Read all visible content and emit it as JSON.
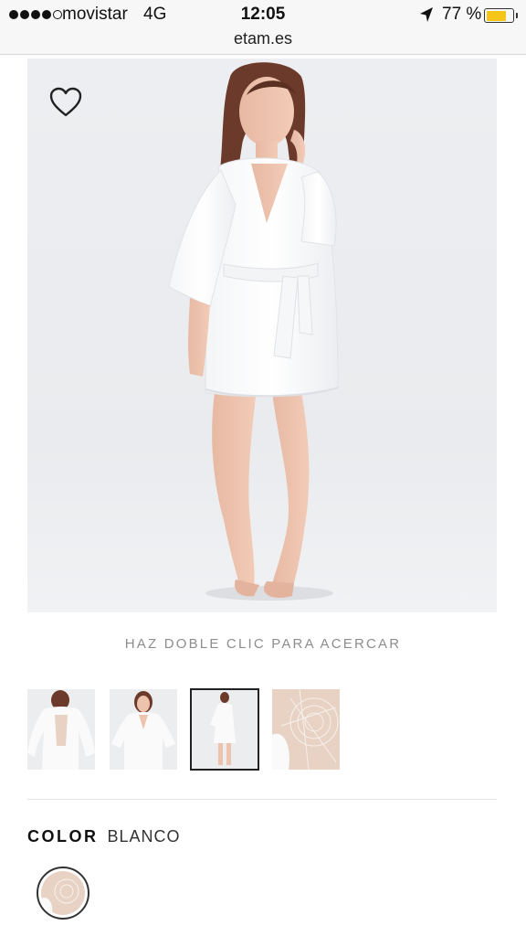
{
  "status_bar": {
    "signal_bars_filled": 4,
    "signal_bars_total": 5,
    "carrier": "movistar",
    "network": "4G",
    "time": "12:05",
    "battery_percent": "77 %",
    "battery_level": 0.77,
    "battery_color": "#f5c518",
    "location_icon": "location-arrow-icon"
  },
  "browser": {
    "url": "etam.es"
  },
  "product": {
    "favorite_icon": "heart-outline-icon",
    "zoom_hint": "HAZ DOBLE CLIC PARA ACERCAR",
    "thumbnails": [
      {
        "view": "back view with lace panel",
        "selected": false
      },
      {
        "view": "front view waist up",
        "selected": false
      },
      {
        "view": "full body front view",
        "selected": true
      },
      {
        "view": "lace detail close-up",
        "selected": false
      }
    ],
    "color_label": "COLOR",
    "color_value": "BLANCO",
    "colors": {
      "accent": "#222222",
      "hint_text": "#8d8d8d",
      "garment": "#fbfbfb",
      "lace": "#e7d2c4"
    }
  }
}
